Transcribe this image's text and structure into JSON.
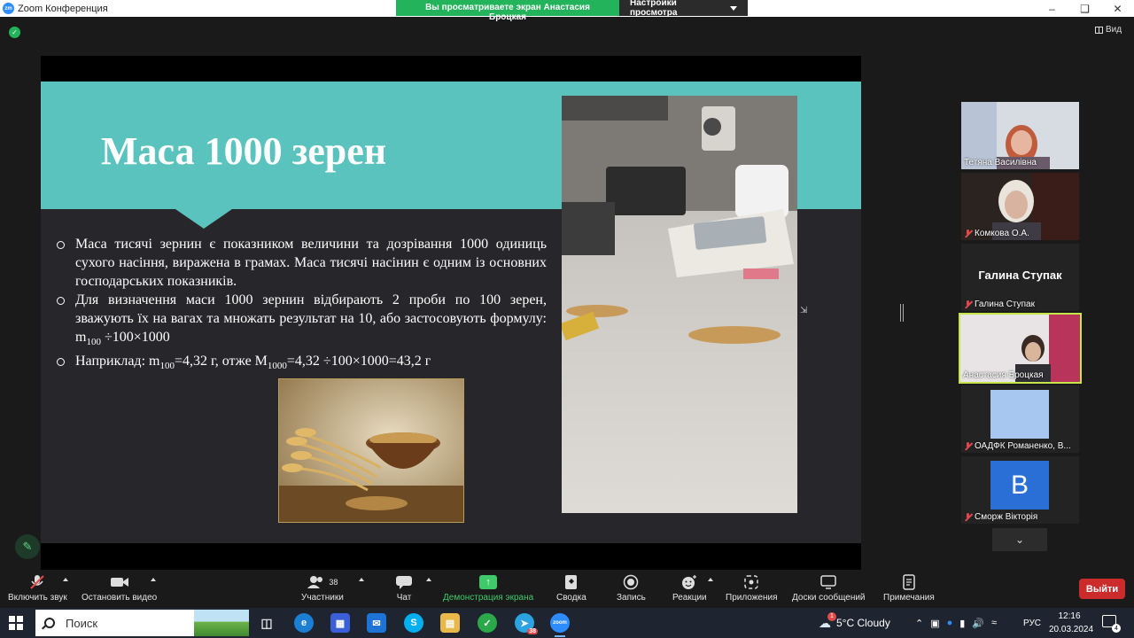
{
  "window": {
    "title": "Zoom Конференция",
    "share_banner": "Вы просматриваете экран Анастасия Броцкая",
    "view_settings": "Настройки просмотра",
    "view_button": "Вид"
  },
  "slide": {
    "title": "Маса 1000 зерен",
    "bullet1": "Маса тисячі зернин є показником величини та дозрівання 1000 одиниць сухого насіння, виражена в грамах. Маса тисячі насінин є одним із основних господарських показників.",
    "bullet2_text": "Для визначення маси 1000 зернин відбирають 2 проби по 100 зерен, зважують їх на вагах та множать результат на 10, або застосовують формулу: m",
    "bullet2_sub": "100",
    "bullet2_tail": " ÷100×1000",
    "bullet3_a": "Наприклад: m",
    "bullet3_sub1": "100",
    "bullet3_b": "=4,32 г, отже M",
    "bullet3_sub2": "1000",
    "bullet3_c": "=4,32 ÷100×1000=43,2 г"
  },
  "participants": [
    {
      "name": "Тетяна Василівна",
      "muted": false
    },
    {
      "name": "Комкова О.А.",
      "muted": true
    },
    {
      "name": "Галина Ступак",
      "muted": true,
      "display": "Галина Ступак"
    },
    {
      "name": "Анастасия Броцкая",
      "muted": false
    },
    {
      "name": "ОАДФК Романенко, В...",
      "muted": true
    },
    {
      "name": "Сморж Вікторія",
      "muted": true,
      "initial": "В"
    }
  ],
  "toolbar": {
    "unmute": "Включить звук",
    "start_video": "Остановить видео",
    "participants": "Участники",
    "participants_count": "38",
    "chat": "Чат",
    "share_screen": "Демонстрация экрана",
    "summary": "Сводка",
    "record": "Запись",
    "reactions": "Реакции",
    "apps": "Приложения",
    "whiteboards": "Доски сообщений",
    "notes": "Примечания",
    "leave": "Выйти"
  },
  "taskbar": {
    "search_placeholder": "Поиск",
    "weather": "5°C  Cloudy",
    "weather_badge": "1",
    "language": "РУС",
    "time": "12:16",
    "date": "20.03.2024",
    "telegram_badge": "38",
    "notif_count": "4"
  },
  "colors": {
    "slide_header": "#5bc3bd",
    "slide_body": "#27272b",
    "share_green": "#23b35a",
    "active_speaker": "#c6e54a",
    "leave_red": "#cc2b2b"
  }
}
